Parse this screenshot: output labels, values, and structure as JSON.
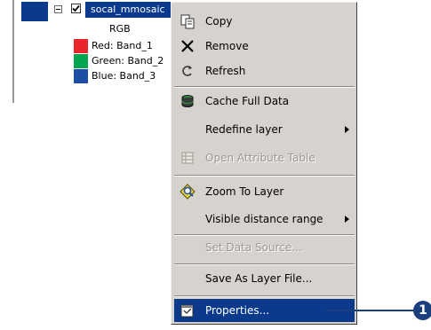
{
  "toc": {
    "layer_name": "socal_mmosaic",
    "renderer_label": "RGB",
    "bands": [
      {
        "label": "Red:  Band_1",
        "color": "#e8262b"
      },
      {
        "label": "Green: Band_2",
        "color": "#00a650"
      },
      {
        "label": "Blue:  Band_3",
        "color": "#1d4ea5"
      }
    ]
  },
  "menu": {
    "copy": "Copy",
    "remove": "Remove",
    "refresh": "Refresh",
    "cache_full_data": "Cache Full Data",
    "redefine_layer": "Redefine layer",
    "open_attribute_table": "Open Attribute Table",
    "zoom_to_layer": "Zoom To Layer",
    "visible_distance_range": "Visible distance range",
    "set_data_source": "Set Data Source...",
    "save_as_layer_file": "Save As Layer File...",
    "properties": "Properties..."
  },
  "callout": {
    "number": "1",
    "color": "#1a3f7c"
  },
  "colors": {
    "selection": "#0b3a8c",
    "menu_bg": "#d6d3ce"
  }
}
